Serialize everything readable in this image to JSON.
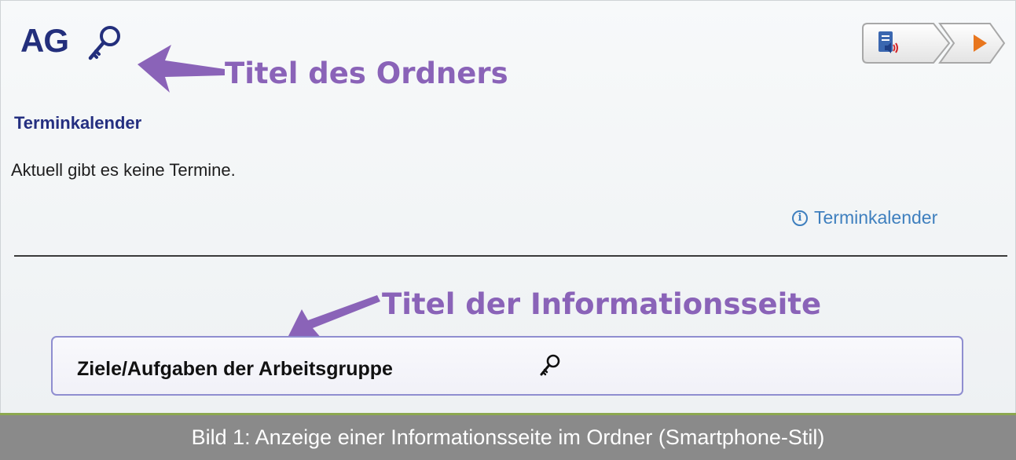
{
  "folder": {
    "title": "AG",
    "lock_icon": "key-icon"
  },
  "annotations": {
    "folder_title": "Titel des Ordners",
    "info_page_title": "Titel der Informationsseite"
  },
  "toolbar": {
    "read_aloud_icon": "speaker-document-icon",
    "play_icon": "play-icon"
  },
  "calendar": {
    "heading": "Terminkalender",
    "empty_message": "Aktuell gibt es keine Termine.",
    "link_label": "Terminkalender",
    "link_icon": "info-icon"
  },
  "info_page": {
    "title": "Ziele/Aufgaben der Arbeitsgruppe",
    "lock_icon": "key-icon"
  },
  "caption": "Bild 1: Anzeige einer Informationsseite im Ordner (Smartphone-Stil)",
  "colors": {
    "title_blue": "#232f7c",
    "annotation_purple": "#8a63b8",
    "link_blue": "#3e7fbe",
    "caption_bg": "#8a8a8a",
    "accent_green": "#8ca84f",
    "play_orange": "#e8761e"
  }
}
